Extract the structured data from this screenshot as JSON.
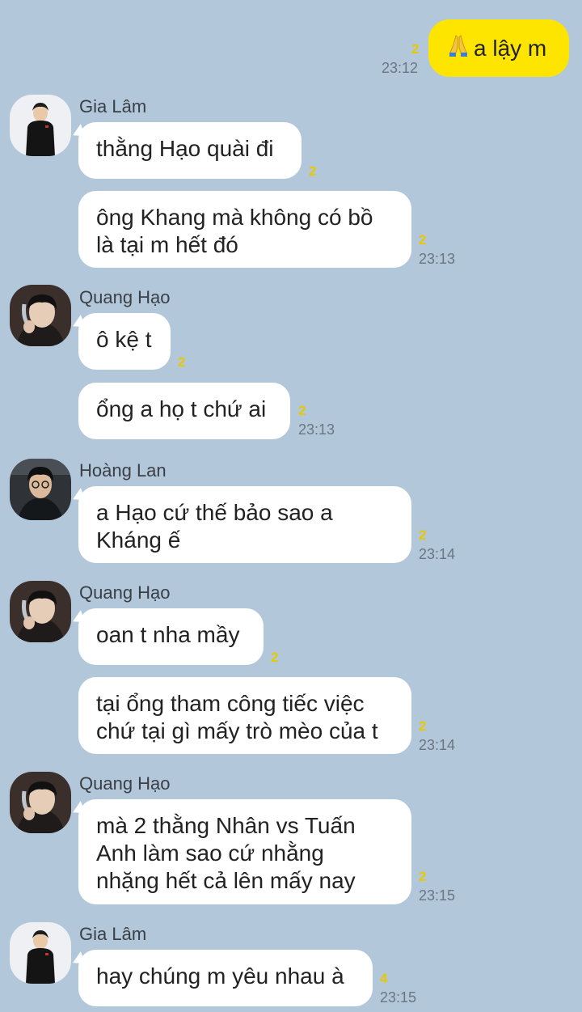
{
  "colors": {
    "background": "#b2c7da",
    "my_bubble": "#fee500",
    "other_bubble": "#ffffff",
    "unread_count": "#e8c800",
    "timestamp": "#6b7680"
  },
  "my_message": {
    "text": "a lậy m",
    "emoji_icon": "folded-hands-icon",
    "unread": "2",
    "time": "23:12"
  },
  "groups": [
    {
      "sender": "Gia Lâm",
      "avatar": "avatar-gia-lam",
      "messages": [
        {
          "lines": [
            "thằng Hạo quài đi"
          ],
          "unread": "2",
          "time": ""
        },
        {
          "lines": [
            "ông Khang mà không có bồ",
            "là tại m hết đó"
          ],
          "unread": "2",
          "time": "23:13"
        }
      ]
    },
    {
      "sender": "Quang Hạo",
      "avatar": "avatar-quang-hao",
      "messages": [
        {
          "lines": [
            "ô kệ t"
          ],
          "unread": "2",
          "time": ""
        },
        {
          "lines": [
            "ổng a họ t chứ ai"
          ],
          "unread": "2",
          "time": "23:13"
        }
      ]
    },
    {
      "sender": "Hoàng Lan",
      "avatar": "avatar-hoang-lan",
      "messages": [
        {
          "lines": [
            "a Hạo cứ thế bảo sao a",
            "Kháng ế"
          ],
          "unread": "2",
          "time": "23:14"
        }
      ]
    },
    {
      "sender": "Quang Hạo",
      "avatar": "avatar-quang-hao",
      "messages": [
        {
          "lines": [
            "oan t nha mầy"
          ],
          "unread": "2",
          "time": ""
        },
        {
          "lines": [
            "tại ổng tham công tiếc việc",
            "chứ tại gì mấy trò mèo của t"
          ],
          "unread": "2",
          "time": "23:14"
        }
      ]
    },
    {
      "sender": "Quang Hạo",
      "avatar": "avatar-quang-hao",
      "messages": [
        {
          "lines": [
            "mà 2 thằng Nhân vs Tuấn",
            "Anh làm sao cứ nhằng",
            "nhặng hết cả lên mấy nay"
          ],
          "unread": "2",
          "time": "23:15"
        }
      ]
    },
    {
      "sender": "Gia Lâm",
      "avatar": "avatar-gia-lam",
      "messages": [
        {
          "lines": [
            "hay chúng m yêu nhau à"
          ],
          "unread": "4",
          "time": "23:15"
        }
      ]
    }
  ]
}
